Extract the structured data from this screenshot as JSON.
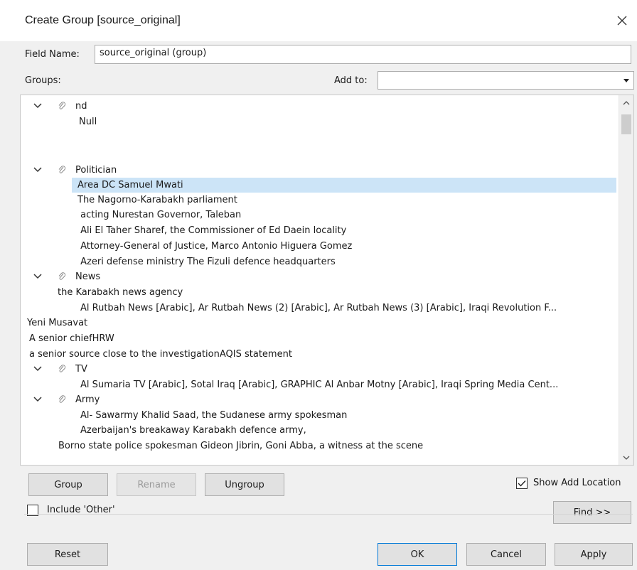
{
  "window": {
    "title": "Create Group [source_original]"
  },
  "field_name": {
    "label": "Field Name:",
    "value": "source_original (group)"
  },
  "groups_label": "Groups:",
  "add_to": {
    "label": "Add to:",
    "value": ""
  },
  "tree": {
    "groups": [
      {
        "name": "nd",
        "members": [
          "Null"
        ]
      },
      {
        "name": "Politician",
        "members": [
          "Area DC Samuel Mwati",
          "The Nagorno-Karabakh parliament",
          " acting Nurestan Governor, Taleban",
          " Ali El Taher Sharef, the Commissioner of Ed Daein locality",
          " Attorney-General of Justice, Marco Antonio Higuera Gomez",
          " Azeri defense ministry The Fizuli defence headquarters"
        ]
      },
      {
        "name": "News",
        "members": [
          "the Karabakh news agency",
          "Al Rutbah News [Arabic], Ar Rutbah News (2) [Arabic], Ar Rutbah News (3) [Arabic], Iraqi Revolution F..."
        ]
      },
      {
        "name": "TV",
        "members": [
          "Al Sumaria TV [Arabic], Sotal Iraq [Arabic], GRAPHIC Al Anbar Motny [Arabic], Iraqi Spring Media Cent..."
        ]
      },
      {
        "name": "Army",
        "members": [
          "Al- Sawarmy Khalid Saad, the Sudanese army spokesman",
          "Azerbaijan's breakaway Karabakh defence army,"
        ]
      }
    ],
    "ungrouped": [
      "Yeni Musavat",
      "A senior chiefHRW",
      "a senior source close to the investigationAQIS statement",
      "Borno state police spokesman Gideon Jibrin, Goni Abba, a witness at the scene"
    ]
  },
  "buttons": {
    "group": "Group",
    "rename": "Rename",
    "ungroup": "Ungroup",
    "find": "Find >>",
    "reset": "Reset",
    "ok": "OK",
    "cancel": "Cancel",
    "apply": "Apply"
  },
  "show_add_location": {
    "label": "Show Add Location",
    "checked": true
  },
  "include_other": {
    "label": "Include 'Other'",
    "checked": false
  },
  "colors": {
    "selection": "#cce4f7",
    "dialog_bg": "#f0f0f0",
    "ok_border": "#0078d7"
  }
}
